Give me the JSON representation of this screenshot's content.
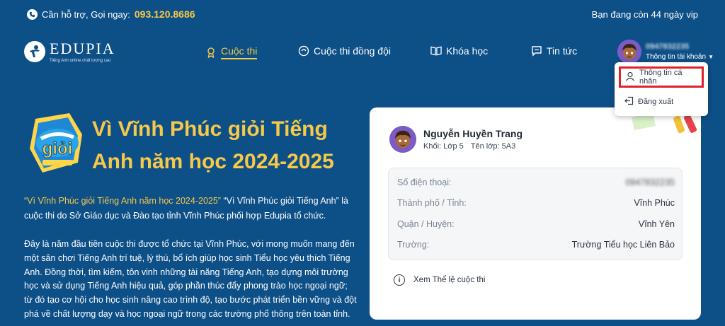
{
  "topbar": {
    "support_text": "Cần hỗ trợ, Gọi ngay:",
    "support_phone": "093.120.8686",
    "vip_text": "Bạn đang còn 44 ngày vip"
  },
  "logo": {
    "name": "EDUPIA",
    "tagline": "Tiếng Anh online chất lượng cao"
  },
  "nav": {
    "items": [
      {
        "label": "Cuộc thi",
        "icon": "medal-icon"
      },
      {
        "label": "Cuộc thi đồng đội",
        "icon": "team-icon"
      },
      {
        "label": "Khóa học",
        "icon": "book-icon"
      },
      {
        "label": "Tin tức",
        "icon": "chat-icon"
      }
    ]
  },
  "account": {
    "phone": "0947832235",
    "label": "Thông tin tài khoản"
  },
  "dropdown": {
    "profile": "Thông tin cá nhân",
    "logout": "Đăng xuất"
  },
  "hero": {
    "badge_text": "giỏi",
    "title": "Vì Vĩnh Phúc giỏi Tiếng Anh năm học 2024-2025",
    "intro_highlight": "“Vì Vĩnh Phúc giỏi Tiếng Anh năm học 2024-2025”",
    "intro_rest": " “Vì Vĩnh Phúc giỏi Tiếng Anh” là cuộc thi do Sở Giáo dục và Đào tạo tỉnh Vĩnh Phúc phối hợp Edupia tổ chức.",
    "paragraph2": "Đây là năm đầu tiên cuộc thi được tổ chức tại Vĩnh Phúc, với mong muốn mang đến một sân chơi Tiếng Anh trí tuệ, lý thú, bổ ích giúp học sinh Tiểu học yêu thích Tiếng Anh. Đồng thời, tìm kiếm, tôn vinh những tài năng Tiếng Anh, tạo dựng môi trường học và sử dụng Tiếng Anh hiệu quả, góp phần thúc đẩy phong trào học ngoại ngữ; từ đó tạo cơ hội cho học sinh nâng cao trình độ, tạo bước phát triển bền vững và đột phá về chất lượng dạy và học ngoại ngữ trong các trường phổ thông trên toàn tỉnh."
  },
  "card": {
    "student_name": "Nguyễn Huyền Trang",
    "grade": "Khối: Lớp 5",
    "class_name": "Tên lớp: 5A3",
    "rows": [
      {
        "label": "Số điện thoại:",
        "value": "0947832235"
      },
      {
        "label": "Thành phố / Tỉnh:",
        "value": "Vĩnh Phúc"
      },
      {
        "label": "Quận / Huyện:",
        "value": "Vĩnh Yên"
      },
      {
        "label": "Trường:",
        "value": "Trường Tiểu học Liên Bảo"
      }
    ],
    "rules_link": "Xem Thể lệ cuộc thi"
  },
  "colors": {
    "background": "#0d4f87",
    "accent_yellow": "#f7c948",
    "highlight_border": "#e0202a"
  }
}
